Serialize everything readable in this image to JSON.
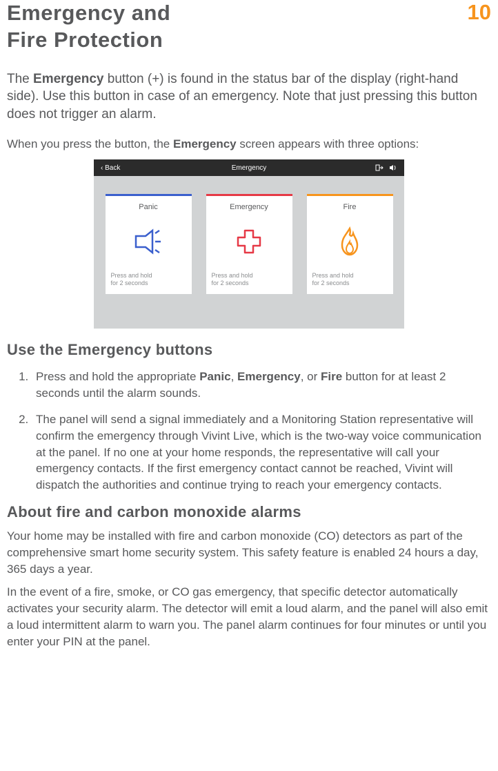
{
  "header": {
    "title_line1": "Emergency and",
    "title_line2": "Fire Protection",
    "page_number": "10"
  },
  "intro": {
    "pre": "The ",
    "bold1": "Emergency",
    "mid": " button (+) is found in the status bar of the display (right-hand side). Use this button in case of an emergency. Note that just pressing this button does not trigger an alarm."
  },
  "sub": {
    "pre": "When you press the button, the ",
    "bold": "Emergency",
    "post": " screen appears with three options:"
  },
  "screenshot": {
    "back": "‹ Back",
    "title": "Emergency",
    "cards": {
      "panic": {
        "title": "Panic",
        "caption1": "Press and hold",
        "caption2": "for 2 seconds"
      },
      "emergency": {
        "title": "Emergency",
        "caption1": "Press and hold",
        "caption2": "for 2 seconds"
      },
      "fire": {
        "title": "Fire",
        "caption1": "Press and hold",
        "caption2": "for 2 seconds"
      }
    }
  },
  "section1": {
    "heading": "Use the Emergency buttons",
    "step1": {
      "pre": "Press and hold the appropriate ",
      "b1": "Panic",
      "s1": ", ",
      "b2": "Emergency",
      "s2": ", or ",
      "b3": "Fire",
      "post": " button for at least 2 seconds until the alarm sounds."
    },
    "step2": "The panel will send a signal immediately and a Monitoring Station representative will confirm the emergency through Vivint Live, which is the two-way voice communication at the panel. If no one at your home responds, the representative will call your emergency contacts. If the first emergency contact cannot be reached, Vivint will dispatch the authorities and continue trying to reach your emergency contacts."
  },
  "section2": {
    "heading": "About fire and carbon monoxide alarms",
    "p1": "Your home may be installed with fire and carbon monoxide (CO) detectors as part of the comprehensive smart home security system. This safety feature is enabled 24 hours a day, 365 days a year.",
    "p2": "In the event of a fire, smoke, or CO gas emergency, that specific detector automatically activates your security alarm. The detector will emit a loud alarm, and the panel will also emit a loud intermittent alarm to warn you. The panel alarm continues for four minutes or until you enter your PIN at the panel."
  }
}
